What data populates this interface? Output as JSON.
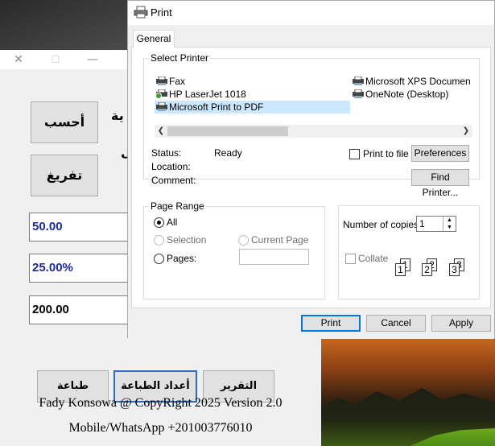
{
  "app": {
    "titlebar": {
      "close_glyph": "✕",
      "maximize_glyph": "☐",
      "minimize_glyph": "—"
    },
    "calculate_button": "أحسب",
    "clear_button": "تفريغ",
    "partial_label_1": "ية",
    "partial_label_2": "ل",
    "fields": {
      "amount": "50.00",
      "percentage": "25.00%",
      "result": "200.00"
    },
    "bottom_buttons": {
      "print": "طباعة",
      "print_settings": "أعداد الطباعة",
      "report": "التقرير"
    },
    "footer": {
      "copyright": "Fady Konsowa @ CopyRight 2025 Version 2.0",
      "contact": "Mobile/WhatsApp +201003776010"
    }
  },
  "print_dialog": {
    "title": "Print",
    "tab": "General",
    "select_printer": {
      "legend": "Select Printer",
      "printers": [
        {
          "name": "Fax",
          "icon": "fax-printer-icon",
          "selected": false
        },
        {
          "name": "HP LaserJet 1018",
          "icon": "default-printer-icon",
          "selected": false
        },
        {
          "name": "Microsoft Print to PDF",
          "icon": "printer-icon",
          "selected": true
        },
        {
          "name": "Microsoft XPS Documen",
          "icon": "printer-icon",
          "selected": false
        },
        {
          "name": "OneNote (Desktop)",
          "icon": "printer-icon",
          "selected": false
        }
      ],
      "status_label": "Status:",
      "status_value": "Ready",
      "location_label": "Location:",
      "comment_label": "Comment:",
      "print_to_file": "Print to file",
      "preferences_button": "Preferences",
      "find_printer_button": "Find Printer..."
    },
    "page_range": {
      "legend": "Page Range",
      "all": "All",
      "selection": "Selection",
      "current_page": "Current Page",
      "pages": "Pages:"
    },
    "copies": {
      "label": "Number of copies:",
      "value": "1",
      "collate": "Collate"
    },
    "buttons": {
      "print": "Print",
      "cancel": "Cancel",
      "apply": "Apply"
    }
  }
}
